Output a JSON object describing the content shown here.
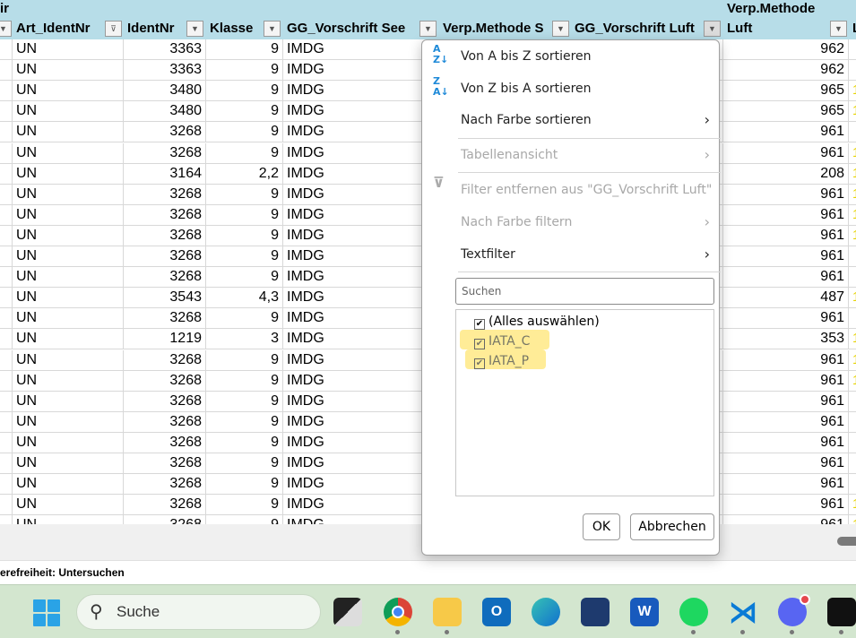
{
  "header_top": {
    "left_text": "ir",
    "verp_luft_line1": "Verp.Methode"
  },
  "columns": [
    {
      "label": ""
    },
    {
      "label": "Art_IdentNr"
    },
    {
      "label": "IdentNr"
    },
    {
      "label": "Klasse"
    },
    {
      "label": "GG_Vorschrift See"
    },
    {
      "label": "Verp.Methode S"
    },
    {
      "label": "GG_Vorschrift Luft"
    },
    {
      "label": "Luft"
    },
    {
      "label": "L"
    }
  ],
  "rows": [
    {
      "art": "UN",
      "ident": "3363",
      "klasse": "9",
      "see": "IMDG",
      "luft": "962",
      "ind": ""
    },
    {
      "art": "UN",
      "ident": "3363",
      "klasse": "9",
      "see": "IMDG",
      "luft": "962",
      "ind": ""
    },
    {
      "art": "UN",
      "ident": "3480",
      "klasse": "9",
      "see": "IMDG",
      "luft": "965",
      "ind": "1"
    },
    {
      "art": "UN",
      "ident": "3480",
      "klasse": "9",
      "see": "IMDG",
      "luft": "965",
      "ind": "1"
    },
    {
      "art": "UN",
      "ident": "3268",
      "klasse": "9",
      "see": "IMDG",
      "luft": "961",
      "ind": ""
    },
    {
      "art": "UN",
      "ident": "3268",
      "klasse": "9",
      "see": "IMDG",
      "luft": "961",
      "ind": "1"
    },
    {
      "art": "UN",
      "ident": "3164",
      "klasse": "2,2",
      "see": "IMDG",
      "luft": "208",
      "ind": "1"
    },
    {
      "art": "UN",
      "ident": "3268",
      "klasse": "9",
      "see": "IMDG",
      "luft": "961",
      "ind": "1"
    },
    {
      "art": "UN",
      "ident": "3268",
      "klasse": "9",
      "see": "IMDG",
      "luft": "961",
      "ind": "1"
    },
    {
      "art": "UN",
      "ident": "3268",
      "klasse": "9",
      "see": "IMDG",
      "luft": "961",
      "ind": "1"
    },
    {
      "art": "UN",
      "ident": "3268",
      "klasse": "9",
      "see": "IMDG",
      "luft": "961",
      "ind": ""
    },
    {
      "art": "UN",
      "ident": "3268",
      "klasse": "9",
      "see": "IMDG",
      "luft": "961",
      "ind": ""
    },
    {
      "art": "UN",
      "ident": "3543",
      "klasse": "4,3",
      "see": "IMDG",
      "luft": "487",
      "ind": "1"
    },
    {
      "art": "UN",
      "ident": "3268",
      "klasse": "9",
      "see": "IMDG",
      "luft": "961",
      "ind": ""
    },
    {
      "art": "UN",
      "ident": "1219",
      "klasse": "3",
      "see": "IMDG",
      "luft": "353",
      "ind": "1"
    },
    {
      "art": "UN",
      "ident": "3268",
      "klasse": "9",
      "see": "IMDG",
      "luft": "961",
      "ind": "1"
    },
    {
      "art": "UN",
      "ident": "3268",
      "klasse": "9",
      "see": "IMDG",
      "luft": "961",
      "ind": "1"
    },
    {
      "art": "UN",
      "ident": "3268",
      "klasse": "9",
      "see": "IMDG",
      "luft": "961",
      "ind": ""
    },
    {
      "art": "UN",
      "ident": "3268",
      "klasse": "9",
      "see": "IMDG",
      "luft": "961",
      "ind": ""
    },
    {
      "art": "UN",
      "ident": "3268",
      "klasse": "9",
      "see": "IMDG",
      "luft": "961",
      "ind": ""
    },
    {
      "art": "UN",
      "ident": "3268",
      "klasse": "9",
      "see": "IMDG",
      "luft": "961",
      "ind": ""
    },
    {
      "art": "UN",
      "ident": "3268",
      "klasse": "9",
      "see": "IMDG",
      "luft": "961",
      "ind": ""
    },
    {
      "art": "UN",
      "ident": "3268",
      "klasse": "9",
      "see": "IMDG",
      "luft": "961",
      "ind": "1"
    },
    {
      "art": "UN",
      "ident": "3268",
      "klasse": "9",
      "see": "IMDG",
      "luft": "961",
      "ind": "1"
    }
  ],
  "menu": {
    "sort_az": "Von A bis Z sortieren",
    "sort_za": "Von Z bis A sortieren",
    "sort_color": "Nach Farbe sortieren",
    "table_view": "Tabellenansicht",
    "remove_filter": "Filter entfernen aus \"GG_Vorschrift Luft\"",
    "filter_color": "Nach Farbe filtern",
    "text_filter": "Textfilter",
    "search_placeholder": "Suchen",
    "items": [
      {
        "label": "(Alles auswählen)",
        "checked": true
      },
      {
        "label": "IATA_C",
        "checked": true
      },
      {
        "label": "IATA_P",
        "checked": true
      }
    ],
    "ok": "OK",
    "cancel": "Abbrechen"
  },
  "status": {
    "text": "erefreiheit: Untersuchen"
  },
  "taskbar": {
    "search_label": "Suche",
    "apps": [
      "task-view",
      "chrome",
      "file-explorer",
      "outlook",
      "edge",
      "microsoft-store",
      "word",
      "spotify",
      "vscode",
      "discord",
      "webex"
    ]
  }
}
